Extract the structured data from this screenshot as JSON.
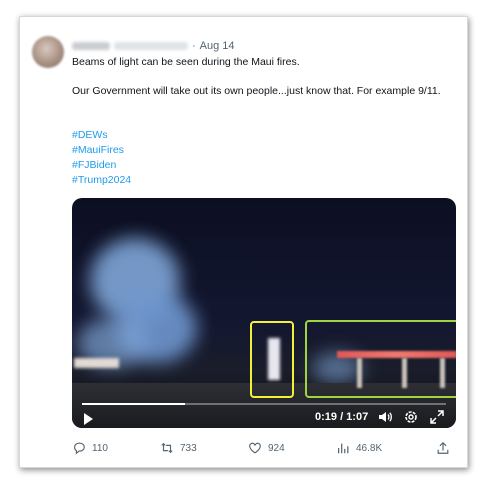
{
  "tweet": {
    "author_name": "",
    "author_handle": "",
    "date": "Aug 14",
    "separator": "·",
    "line1": "Beams of light can be seen during the Maui fires.",
    "line2": "Our Government will take out its own people...just know that. For example 9/11.",
    "hashtags": [
      "#DEWs",
      "#MauiFires",
      "#FJBiden",
      "#Trump2024"
    ]
  },
  "video": {
    "time_display": "0:19 / 1:07",
    "progress": 0.284,
    "icons": [
      "play-icon",
      "volume-icon",
      "settings-icon",
      "fullscreen-icon"
    ],
    "annotation_colors": {
      "yellow": "#f3ef3b",
      "green": "#9fd53f"
    }
  },
  "actions": {
    "replies": "110",
    "retweets": "733",
    "likes": "924",
    "views": "46.8K"
  },
  "colors": {
    "text": "#0f1419",
    "muted": "#536471",
    "link": "#1d9bf0"
  }
}
